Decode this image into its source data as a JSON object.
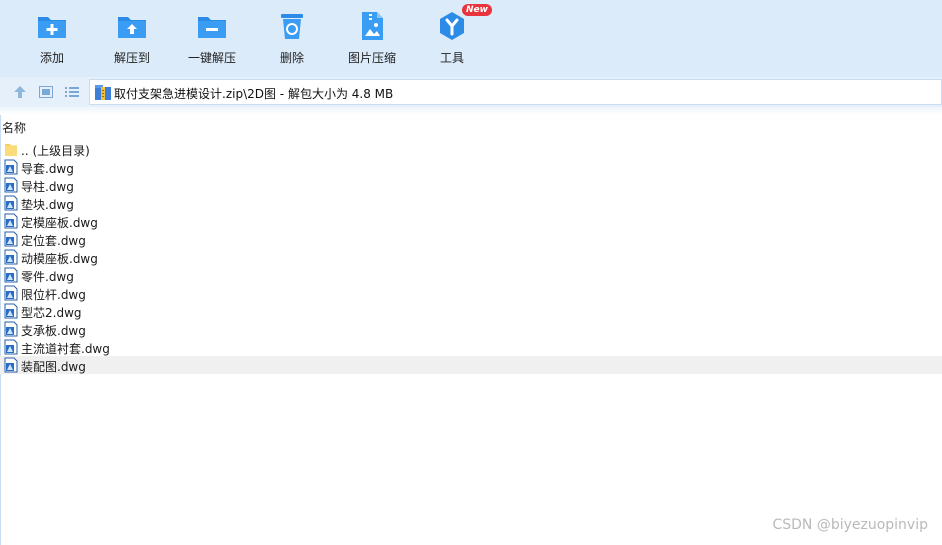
{
  "toolbar": {
    "items": [
      {
        "label": "添加",
        "icon": "add-folder-icon"
      },
      {
        "label": "解压到",
        "icon": "extract-to-icon"
      },
      {
        "label": "一键解压",
        "icon": "one-click-extract-icon"
      },
      {
        "label": "删除",
        "icon": "recycle-delete-icon"
      },
      {
        "label": "图片压缩",
        "icon": "image-compress-icon"
      },
      {
        "label": "工具",
        "icon": "tools-icon",
        "badge": "New"
      }
    ]
  },
  "address": {
    "path": "取付支架急进模设计.zip\\2D图 - 解包大小为 4.8 MB"
  },
  "list": {
    "column_name": "名称",
    "items": [
      {
        "name": ".. (上级目录)",
        "type": "folder"
      },
      {
        "name": "导套.dwg",
        "type": "dwg"
      },
      {
        "name": "导柱.dwg",
        "type": "dwg"
      },
      {
        "name": "垫块.dwg",
        "type": "dwg"
      },
      {
        "name": "定模座板.dwg",
        "type": "dwg"
      },
      {
        "name": "定位套.dwg",
        "type": "dwg"
      },
      {
        "name": "动模座板.dwg",
        "type": "dwg"
      },
      {
        "name": "零件.dwg",
        "type": "dwg"
      },
      {
        "name": "限位杆.dwg",
        "type": "dwg"
      },
      {
        "name": "型芯2.dwg",
        "type": "dwg"
      },
      {
        "name": "支承板.dwg",
        "type": "dwg"
      },
      {
        "name": "主流道衬套.dwg",
        "type": "dwg"
      },
      {
        "name": "装配图.dwg",
        "type": "dwg",
        "selected": true
      }
    ]
  },
  "watermark": "CSDN @biyezuopinvip",
  "colors": {
    "accent": "#2b8be6",
    "toolbar_bg": "#dcebfa",
    "badge": "#e8343c"
  }
}
